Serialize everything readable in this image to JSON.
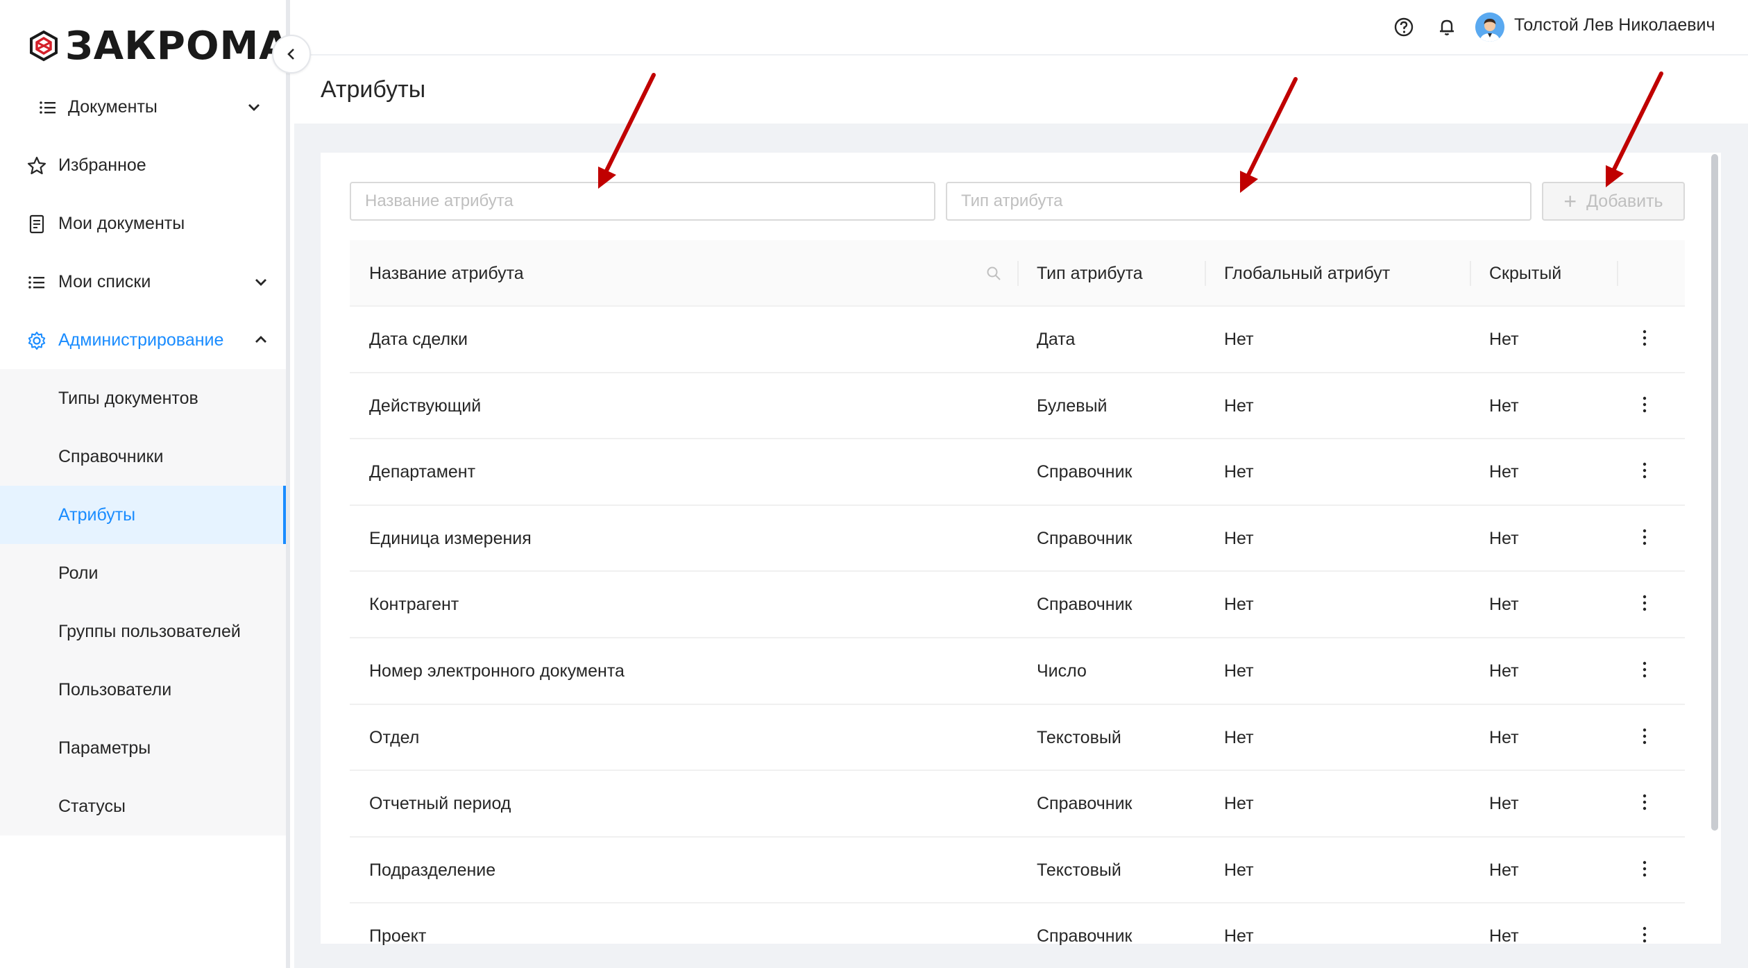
{
  "app": {
    "logo_text": "ЗАКРОМА",
    "accent_color": "#1a8cff",
    "arrow_color": "#c00000"
  },
  "sidebar": {
    "items": [
      {
        "label": "Документы",
        "icon": "list-icon"
      },
      {
        "label": "Избранное",
        "icon": "star-icon"
      },
      {
        "label": "Мои документы",
        "icon": "document-icon"
      },
      {
        "label": "Мои списки",
        "icon": "list-icon"
      },
      {
        "label": "Администрирование",
        "icon": "gear-icon"
      }
    ],
    "admin_items": [
      {
        "label": "Типы документов"
      },
      {
        "label": "Справочники"
      },
      {
        "label": "Атрибуты",
        "selected": true
      },
      {
        "label": "Роли"
      },
      {
        "label": "Группы пользователей"
      },
      {
        "label": "Пользователи"
      },
      {
        "label": "Параметры"
      },
      {
        "label": "Статусы"
      }
    ]
  },
  "header": {
    "user_name": "Толстой Лев Николаевич",
    "icons": [
      "help-icon",
      "bell-icon",
      "avatar"
    ]
  },
  "page": {
    "title": "Атрибуты"
  },
  "toolbar": {
    "name_placeholder": "Название атрибута",
    "type_placeholder": "Тип атрибута",
    "add_label": "Добавить"
  },
  "table": {
    "columns": [
      "Название атрибута",
      "Тип атрибута",
      "Глобальный атрибут",
      "Скрытый"
    ],
    "rows": [
      [
        "Дата сделки",
        "Дата",
        "Нет",
        "Нет"
      ],
      [
        "Действующий",
        "Булевый",
        "Нет",
        "Нет"
      ],
      [
        "Департамент",
        "Справочник",
        "Нет",
        "Нет"
      ],
      [
        "Единица измерения",
        "Справочник",
        "Нет",
        "Нет"
      ],
      [
        "Контрагент",
        "Справочник",
        "Нет",
        "Нет"
      ],
      [
        "Номер электронного документа",
        "Число",
        "Нет",
        "Нет"
      ],
      [
        "Отдел",
        "Текстовый",
        "Нет",
        "Нет"
      ],
      [
        "Отчетный период",
        "Справочник",
        "Нет",
        "Нет"
      ],
      [
        "Подразделение",
        "Текстовый",
        "Нет",
        "Нет"
      ],
      [
        "Проект",
        "Справочник",
        "Нет",
        "Нет"
      ]
    ]
  }
}
